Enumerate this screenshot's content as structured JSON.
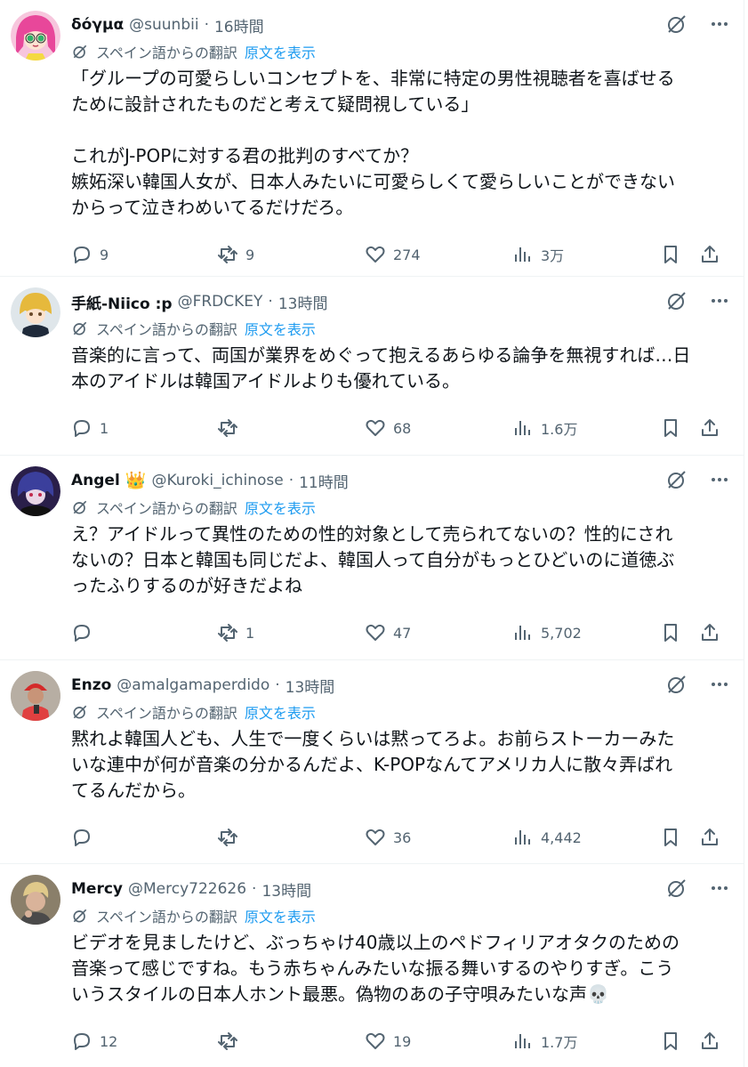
{
  "translate": {
    "label": "スペイン語からの翻訳",
    "show_original": "原文を表示"
  },
  "colors": {
    "text": "#0f1419",
    "secondary": "#536471",
    "link": "#1d9bf0",
    "divider": "#eff3f4"
  },
  "tweets": [
    {
      "name": "δόγμα",
      "badge": "",
      "handle": "@suunbii",
      "time": "16時間",
      "text": "「グループの可愛らしいコンセプトを、非常に特定の男性視聴者を喜ばせる\nために設計されたものだと考えて疑問視している」\n\nこれがJ-POPに対する君の批判のすべてか？\n嫉妬深い韓国人女が、日本人みたいに可愛らしくて愛らしいことができない\nからって泣きわめいてるだけだろ。",
      "replies": "9",
      "reposts": "9",
      "likes": "274",
      "views": "3万",
      "avatar_icon": "pink-hair-anime-avatar"
    },
    {
      "name": "手紙-Niico :p",
      "badge": "",
      "handle": "@FRDCKEY",
      "time": "13時間",
      "text": "音楽的に言って、両国が業界をめぐって抱えるあらゆる論争を無視すれば…日\n本のアイドルは韓国アイドルよりも優れている。",
      "replies": "1",
      "reposts": "",
      "likes": "68",
      "views": "1.6万",
      "avatar_icon": "blonde-anime-avatar"
    },
    {
      "name": "Angel",
      "badge": "👑",
      "handle": "@Kuroki_ichinose",
      "time": "11時間",
      "text": "え？アイドルって異性のための性的対象として売られてないの？性的にされ\nないの？日本と韓国も同じだよ、韓国人って自分がもっとひどいのに道徳ぶ\nったふりするのが好きだよね",
      "replies": "",
      "reposts": "1",
      "likes": "47",
      "views": "5,702",
      "avatar_icon": "dark-blue-anime-avatar"
    },
    {
      "name": "Enzo",
      "badge": "",
      "handle": "@amalgamaperdido",
      "time": "13時間",
      "text": "黙れよ韓国人ども、人生で一度くらいは黙ってろよ。お前らストーカーみた\nいな連中が何が音楽の分かるんだよ、K-POPなんてアメリカ人に散々弄ばれ\nてるんだから。",
      "replies": "",
      "reposts": "",
      "likes": "36",
      "views": "4,442",
      "avatar_icon": "red-cap-photo-avatar"
    },
    {
      "name": "Mercy",
      "badge": "",
      "handle": "@Mercy722626",
      "time": "13時間",
      "text": "ビデオを見ましたけど、ぶっちゃけ40歳以上のペドフィリアオタクのための\n音楽って感じですね。もう赤ちゃんみたいな振る舞いするのやりすぎ。こう\nいうスタイルの日本人ホント最悪。偽物のあの子守唄みたいな声💀",
      "replies": "12",
      "reposts": "",
      "likes": "19",
      "views": "1.7万",
      "avatar_icon": "blond-man-photo-avatar"
    }
  ]
}
